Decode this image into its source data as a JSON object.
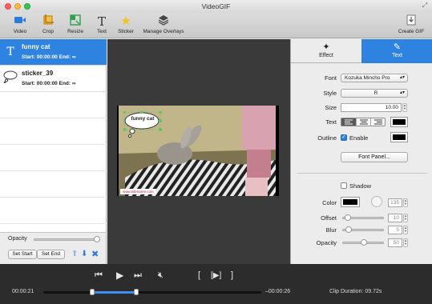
{
  "window": {
    "title": "VideoGIF"
  },
  "toolbar": {
    "items": [
      {
        "label": "Video",
        "icon": "video-camera-icon",
        "color": "#2a7be0"
      },
      {
        "label": "Crop",
        "icon": "crop-icon",
        "color": "#e8a020"
      },
      {
        "label": "Resize",
        "icon": "resize-icon",
        "color": "#2fa04a"
      },
      {
        "label": "Text",
        "icon": "text-icon",
        "color": "#333333"
      },
      {
        "label": "Sticker",
        "icon": "star-icon",
        "color": "#f2c41b"
      },
      {
        "label": "Manage Overlays",
        "icon": "layers-icon",
        "color": "#333333"
      }
    ],
    "create_gif": "Create GIF"
  },
  "overlays": [
    {
      "name": "funny cat",
      "info": "Start: 00:00:00 End: ∞",
      "icon": "text-icon",
      "selected": true
    },
    {
      "name": "sticker_39",
      "info": "Start: 00:00:00 End: ∞",
      "icon": "speech-bubble-icon",
      "selected": false
    }
  ],
  "left_controls": {
    "opacity_label": "Opacity",
    "opacity_value": 1.0,
    "set_start": "Set Start",
    "set_end": "Set End"
  },
  "preview": {
    "bubble_text": "funny cat",
    "watermark": "www.sitename.com"
  },
  "tabs": [
    {
      "label": "Effect",
      "icon": "magic-wand-icon",
      "active": false
    },
    {
      "label": "Text",
      "icon": "edit-icon",
      "active": true
    }
  ],
  "text_settings": {
    "font_label": "Font",
    "font_value": "Kozuka Mincho Pro",
    "style_label": "Style",
    "style_value": "R",
    "size_label": "Size",
    "size_value": "10.00",
    "text_label": "Text",
    "text_color": "#000000",
    "outline_label": "Outline",
    "enable_label": "Enable",
    "outline_enabled": true,
    "outline_color": "#000000",
    "font_panel": "Font Panel..."
  },
  "shadow": {
    "label": "Shadow",
    "enabled": false,
    "color_label": "Color",
    "color": "#000000",
    "angle_value": "135",
    "offset_label": "Offset",
    "offset_value": "10",
    "blur_label": "Blur",
    "blur_value": "5",
    "opacity_label": "Opacity",
    "opacity_value": "50"
  },
  "playback": {
    "current_time": "00:00:21",
    "remaining_time": "–00:00:26",
    "clip_duration": "Clip Duration: 09.72s",
    "progress": 0.43,
    "range_start": 0.23,
    "range_end": 0.43
  },
  "colors": {
    "accent": "#2f83e0",
    "bottom_bar": "#2c2c2c",
    "preview_bg": "#3a3a3a"
  }
}
